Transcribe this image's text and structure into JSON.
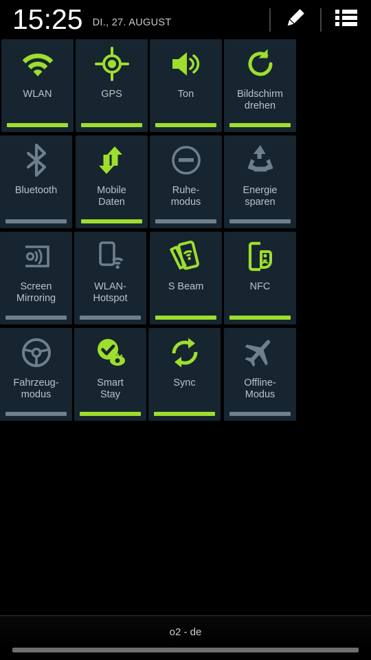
{
  "status_bar": {
    "clock": "15:25",
    "date": "DI., 27. AUGUST",
    "edit_icon": "pencil-icon",
    "list_icon": "list-icon"
  },
  "colors": {
    "tile_bg": "#16252f",
    "accent_on": "#9ede2d",
    "accent_off": "#6f7f8c",
    "label": "#b8c4cc",
    "background": "#000000"
  },
  "tiles": [
    {
      "label": "WLAN",
      "icon": "wifi-icon",
      "state": "on",
      "name": "tile-wlan"
    },
    {
      "label": "GPS",
      "icon": "gps-icon",
      "state": "on",
      "name": "tile-gps"
    },
    {
      "label": "Ton",
      "icon": "sound-icon",
      "state": "on",
      "name": "tile-ton"
    },
    {
      "label": "Bildschirm\ndrehen",
      "icon": "screen-rotate-icon",
      "state": "on",
      "name": "tile-bildschirm-drehen"
    },
    {
      "label": "Bluetooth",
      "icon": "bluetooth-icon",
      "state": "off",
      "name": "tile-bluetooth"
    },
    {
      "label": "Mobile\nDaten",
      "icon": "mobile-data-icon",
      "state": "on",
      "name": "tile-mobile-daten"
    },
    {
      "label": "Ruhe-\nmodus",
      "icon": "do-not-disturb-icon",
      "state": "off",
      "name": "tile-ruhemodus"
    },
    {
      "label": "Energie\nsparen",
      "icon": "power-saving-icon",
      "state": "off",
      "name": "tile-energie-sparen"
    },
    {
      "label": "Screen\nMirroring",
      "icon": "screen-mirroring-icon",
      "state": "off",
      "name": "tile-screen-mirroring"
    },
    {
      "label": "WLAN-\nHotspot",
      "icon": "hotspot-icon",
      "state": "off",
      "name": "tile-wlan-hotspot"
    },
    {
      "label": "S Beam",
      "icon": "s-beam-icon",
      "state": "on",
      "name": "tile-s-beam"
    },
    {
      "label": "NFC",
      "icon": "nfc-icon",
      "state": "on",
      "name": "tile-nfc"
    },
    {
      "label": "Fahrzeug-\nmodus",
      "icon": "steering-wheel-icon",
      "state": "off",
      "name": "tile-fahrzeugmodus"
    },
    {
      "label": "Smart\nStay",
      "icon": "smart-stay-icon",
      "state": "on",
      "name": "tile-smart-stay"
    },
    {
      "label": "Sync",
      "icon": "sync-icon",
      "state": "on",
      "name": "tile-sync"
    },
    {
      "label": "Offline-\nModus",
      "icon": "airplane-icon",
      "state": "off",
      "name": "tile-offline-modus"
    }
  ],
  "bottom": {
    "carrier": "o2 - de",
    "handle": "drag-handle"
  }
}
